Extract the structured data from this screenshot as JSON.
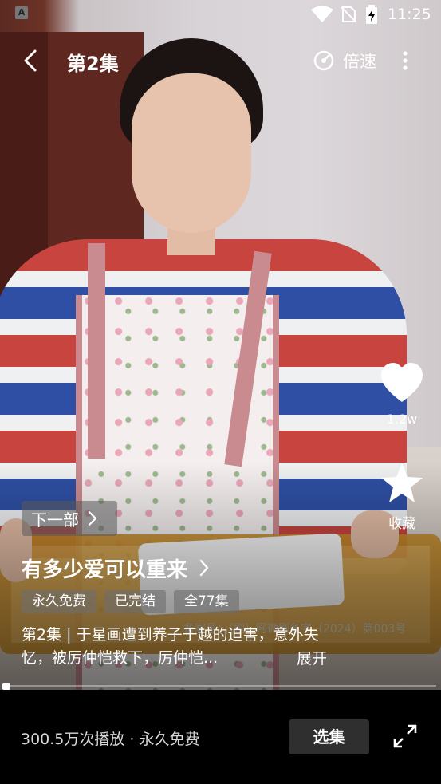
{
  "status_bar": {
    "sim_label": "A",
    "time": "11:25"
  },
  "top_bar": {
    "episode_title": "第2集",
    "speed_label": "倍速"
  },
  "actions": {
    "like_count": "1.2w",
    "favorite_label": "收藏"
  },
  "next_series": {
    "label": "下一部"
  },
  "drama": {
    "title": "有多少爱可以重来",
    "tags": [
      "永久免费",
      "已完结",
      "全77集"
    ],
    "license_text": "备案号：（剧）网微剧备字（2024）第003号",
    "description": "第2集 | 于星画遭到养子于越的迫害，意外失忆，被厉仲恺救下，厉仲恺...",
    "expand_label": "展开"
  },
  "progress": {
    "played_fraction": 0.01
  },
  "bottom_bar": {
    "plays_text": "300.5万次播放 · 永久免费",
    "select_episode_label": "选集"
  },
  "icons": {
    "back": "chevron-left-icon",
    "speed": "speed-dial-icon",
    "more": "more-vertical-icon",
    "like": "heart-icon",
    "favorite": "star-icon",
    "fullscreen": "fullscreen-icon"
  }
}
